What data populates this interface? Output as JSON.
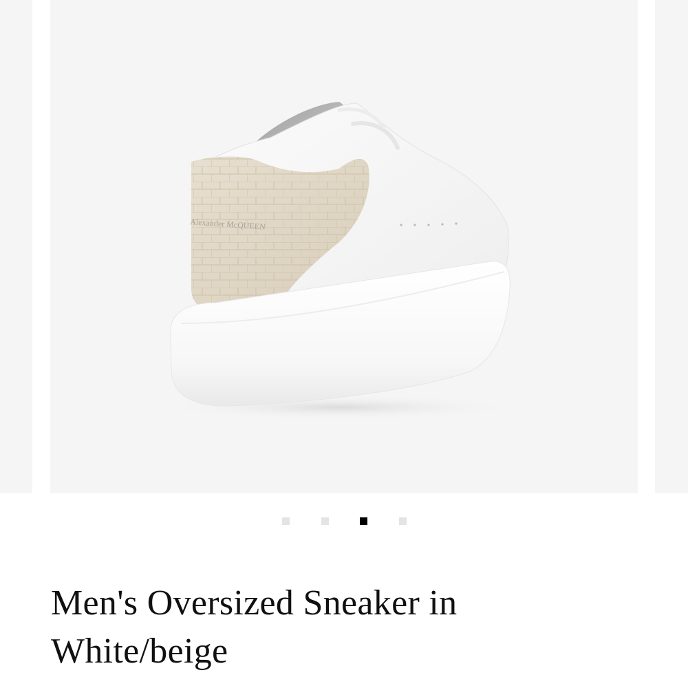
{
  "carousel": {
    "slide_count": 4,
    "active_index": 2,
    "image": {
      "alt": "Men's Oversized Sneaker in White/beige - rear view",
      "heel_tab_text": "Alexander McQUEEN"
    },
    "colors": {
      "slide_background": "#f5f5f5",
      "dot_inactive": "#e4e4e4",
      "dot_active": "#000000"
    }
  },
  "product": {
    "title": "Men's Oversized Sneaker in White/beige"
  }
}
